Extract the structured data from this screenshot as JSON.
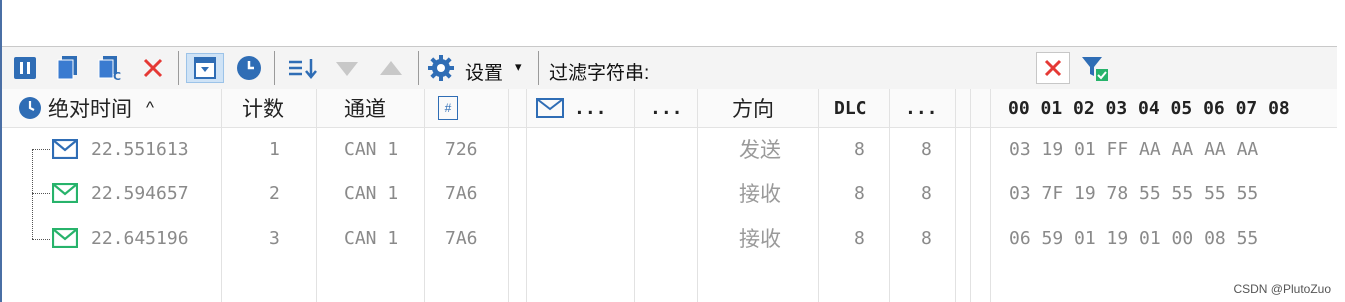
{
  "toolbar": {
    "buttons": [
      {
        "icon": "pause-icon"
      },
      {
        "icon": "copy-icon"
      },
      {
        "icon": "copy-c-icon"
      },
      {
        "icon": "delete-icon"
      },
      {
        "icon": "auto-scroll-icon",
        "active": true
      },
      {
        "icon": "clock-icon"
      },
      {
        "icon": "sort-icon"
      },
      {
        "icon": "arrow-down-icon"
      },
      {
        "icon": "arrow-up-icon"
      },
      {
        "icon": "gear-icon"
      }
    ],
    "settings_label": "设置",
    "settings_caret": "▾",
    "filter_label": "过滤字符串:",
    "filter_value": "",
    "clear_filter_icon": "clear-x-icon",
    "filter_icon": "funnel-check-icon"
  },
  "columns": {
    "time": "绝对时间",
    "time_sort": "^",
    "count": "计数",
    "channel": "通道",
    "id_icon": "#",
    "msg_ellipsis": "...",
    "col6": "...",
    "direction": "方向",
    "dlc": "DLC",
    "col9": "...",
    "bytes": "00 01 02 03 04 05 06 07 08"
  },
  "rows": [
    {
      "icon": "mail-send-icon",
      "icon_color": "#2f6db5",
      "time": "22.551613",
      "count": "1",
      "channel": "CAN 1",
      "id": "726",
      "direction": "发送",
      "dlc": "8",
      "len": "8",
      "data": "03 19 01 FF AA AA AA AA"
    },
    {
      "icon": "mail-receive-icon",
      "icon_color": "#27b36b",
      "time": "22.594657",
      "count": "2",
      "channel": "CAN 1",
      "id": "7A6",
      "direction": "接收",
      "dlc": "8",
      "len": "8",
      "data": "03 7F 19 78 55 55 55 55"
    },
    {
      "icon": "mail-receive-icon",
      "icon_color": "#27b36b",
      "time": "22.645196",
      "count": "3",
      "channel": "CAN 1",
      "id": "7A6",
      "direction": "接收",
      "dlc": "8",
      "len": "8",
      "data": "06 59 01 19 01 00 08 55"
    }
  ],
  "colors": {
    "accent": "#2f6db5",
    "delete": "#e53935",
    "receive": "#27b36b"
  },
  "watermark": "CSDN @PlutoZuo"
}
